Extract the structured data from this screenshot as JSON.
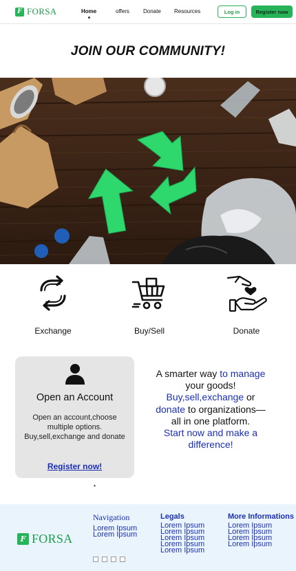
{
  "header": {
    "brand": "FORSA",
    "nav": [
      "Home",
      "offers",
      "Donate",
      "Resources"
    ],
    "login_label": "Log in",
    "register_label": "Register now"
  },
  "page_title": "JOIN OUR COMMUNITY!",
  "features": [
    {
      "label": "Exchange",
      "icon": "exchange-arrows-icon"
    },
    {
      "label": "Buy/Sell",
      "icon": "shopping-cart-icon"
    },
    {
      "label": "Donate",
      "icon": "donate-hands-icon"
    }
  ],
  "account_card": {
    "icon": "user-icon",
    "title": "Open an Account",
    "description": "Open an account,choose multiple options. Buy,sell,exchange and donate",
    "link": "Register now!"
  },
  "tagline": {
    "p1": "A smarter way ",
    "p2": "to manage",
    "p3": " your goods! ",
    "p4": "Buy,sell,exchange",
    "p5": "  or ",
    "p6": "donate",
    "p7": " to organizations—all in one platform.",
    "p8": "Start now and make a difference!"
  },
  "footer": {
    "brand": "FORSA",
    "navigation_title": "Navigation",
    "navigation_links": [
      "Lorem Ipsum",
      "Lorem Ipsum"
    ],
    "legals_title": "Legals",
    "legals_links": [
      "Lorem Ipsum",
      "Lorem Ipsum",
      "Lorem Ipsum",
      "Lorem Ipsum",
      "Lorem Ipsum"
    ],
    "more_title": "More Informations",
    "more_links": [
      "Lorem Ipsum",
      "Lorem Ipsum",
      "Lorem Ipsum",
      "Lorem Ipsum"
    ]
  },
  "colors": {
    "brand_green": "#27b35a",
    "link_blue": "#1b2fb5",
    "footer_bg": "#eaf4fc"
  }
}
